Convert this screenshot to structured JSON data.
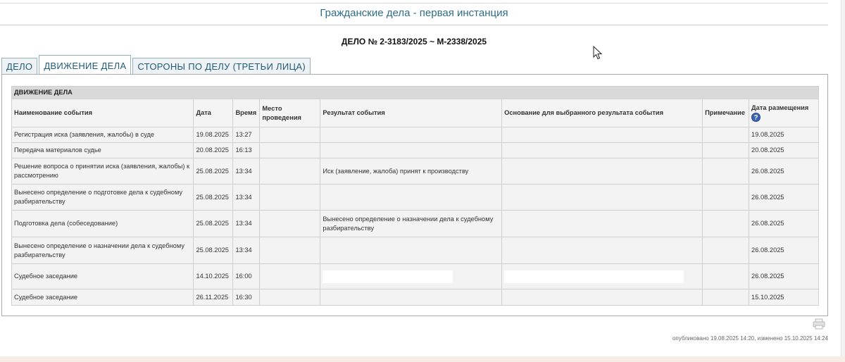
{
  "header": {
    "court_title": "Гражданские дела - первая инстанция",
    "case_number": "ДЕЛО № 2-3183/2025 ~ М-2338/2025"
  },
  "tabs": [
    {
      "label": "ДЕЛО"
    },
    {
      "label": "ДВИЖЕНИЕ ДЕЛА"
    },
    {
      "label": "СТОРОНЫ ПО ДЕЛУ (ТРЕТЬИ ЛИЦА)"
    }
  ],
  "table": {
    "section_title": "ДВИЖЕНИЕ ДЕЛА",
    "columns": {
      "event": "Наименование события",
      "date": "Дата",
      "time": "Время",
      "place": "Место проведения",
      "result": "Результат события",
      "basis": "Основание для выбранного результата события",
      "note": "Примечание",
      "posted": "Дата размещения"
    },
    "rows": [
      {
        "event": "Регистрация иска (заявления, жалобы) в суде",
        "date": "19.08.2025",
        "time": "13:27",
        "place": "",
        "result": "",
        "basis": "",
        "note": "",
        "posted": "19.08.2025"
      },
      {
        "event": "Передача материалов судье",
        "date": "20.08.2025",
        "time": "16:13",
        "place": "",
        "result": "",
        "basis": "",
        "note": "",
        "posted": "20.08.2025"
      },
      {
        "event": "Решение вопроса о принятии иска (заявления, жалобы) к рассмотрению",
        "date": "25.08.2025",
        "time": "13:34",
        "place": "",
        "result": "Иск (заявление, жалоба) принят к производству",
        "basis": "",
        "note": "",
        "posted": "26.08.2025"
      },
      {
        "event": "Вынесено определение о подготовке дела к судебному разбирательству",
        "date": "25.08.2025",
        "time": "13:34",
        "place": "",
        "result": "",
        "basis": "",
        "note": "",
        "posted": "26.08.2025"
      },
      {
        "event": "Подготовка дела (собеседование)",
        "date": "25.08.2025",
        "time": "13:34",
        "place": "",
        "result": "Вынесено определение о назначении дела к судебному разбирательству",
        "basis": "",
        "note": "",
        "posted": "26.08.2025"
      },
      {
        "event": "Вынесено определение о назначении дела к судебному разбирательству",
        "date": "25.08.2025",
        "time": "13:34",
        "place": "",
        "result": "",
        "basis": "",
        "note": "",
        "posted": "26.08.2025"
      },
      {
        "event": "Судебное заседание",
        "date": "14.10.2025",
        "time": "16:00",
        "place": "",
        "result": "",
        "basis": "",
        "note": "",
        "posted": "26.08.2025"
      },
      {
        "event": "Судебное заседание",
        "date": "26.11.2025",
        "time": "16:30",
        "place": "",
        "result": "",
        "basis": "",
        "note": "",
        "posted": "15.10.2025"
      }
    ]
  },
  "footer": {
    "meta": "опубликовано 19.08.2025 14:20, изменено 15.10.2025 14:24"
  },
  "icons": {
    "help": "question-icon",
    "print": "printer-icon",
    "cursor": "mouse-cursor-icon"
  },
  "colors": {
    "accent": "#2e6e8a",
    "help_icon": "#3a63b5"
  }
}
